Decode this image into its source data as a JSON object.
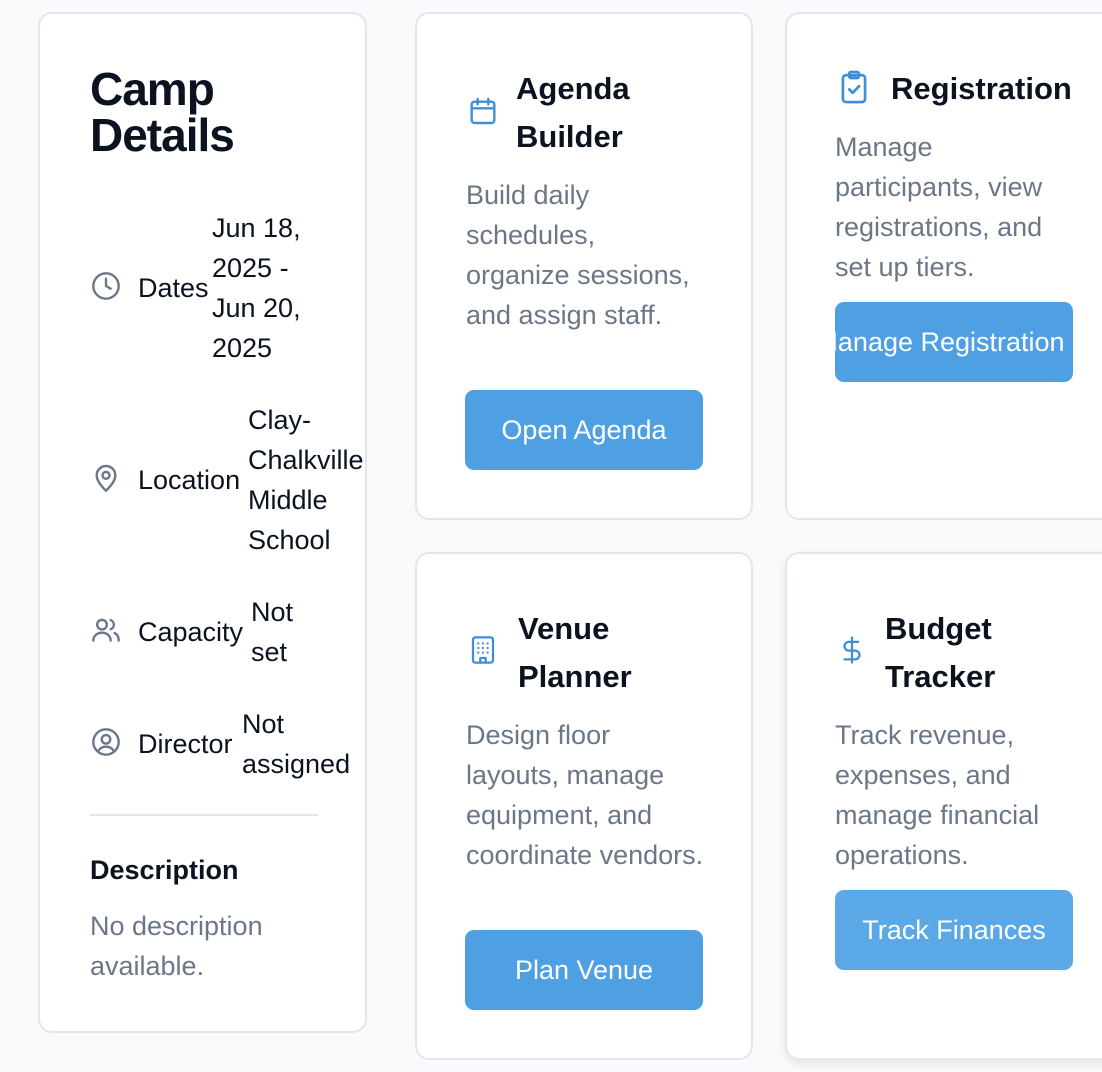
{
  "camp_details": {
    "title": "Camp Details",
    "rows": [
      {
        "icon": "clock-icon",
        "label": "Dates",
        "value": "Jun 18, 2025 - Jun 20, 2025"
      },
      {
        "icon": "map-pin-icon",
        "label": "Location",
        "value": "Clay-Chalkville Middle School"
      },
      {
        "icon": "users-icon",
        "label": "Capacity",
        "value": "Not set"
      },
      {
        "icon": "user-circle-icon",
        "label": "Director",
        "value": "Not assigned"
      }
    ],
    "description_heading": "Description",
    "description_text": "No description available."
  },
  "cards": {
    "agenda": {
      "icon": "calendar-icon",
      "title": "Agenda Builder",
      "description": "Build daily schedules, organize sessions, and assign staff.",
      "button": "Open Agenda"
    },
    "registration": {
      "icon": "clipboard-check-icon",
      "title": "Registration",
      "description": "Manage participants, view registrations, and set up tiers.",
      "button": "Manage Registration"
    },
    "venue": {
      "icon": "building-icon",
      "title": "Venue Planner",
      "description": "Design floor layouts, manage equipment, and coordinate vendors.",
      "button": "Plan Venue"
    },
    "budget": {
      "icon": "dollar-icon",
      "title": "Budget Tracker",
      "description": "Track revenue, expenses, and manage financial operations.",
      "button": "Track Finances"
    }
  },
  "colors": {
    "accent": "#4ea0e2",
    "icon_accent": "#3d8fd8",
    "muted_text": "#6b7789",
    "border": "#e3e7ed"
  }
}
